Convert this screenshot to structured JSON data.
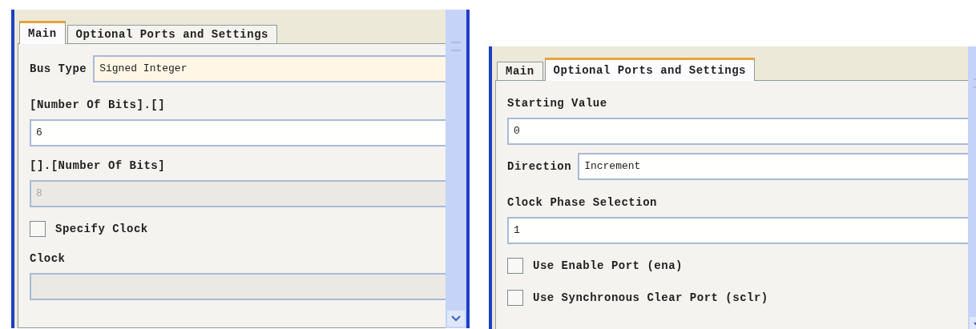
{
  "panels": [
    {
      "tabs": [
        {
          "label": "Main",
          "selected": true
        },
        {
          "label": "Optional Ports and Settings",
          "selected": false
        }
      ],
      "rows": [
        {
          "kind": "inline_field",
          "label": "Bus Type",
          "value": "Signed Integer",
          "focused": true
        },
        {
          "kind": "label",
          "label": "[Number Of Bits].[]"
        },
        {
          "kind": "field",
          "value": "6",
          "disabled": false
        },
        {
          "kind": "label",
          "label": "[].[Number Of Bits]"
        },
        {
          "kind": "field",
          "value": "8",
          "disabled": true
        },
        {
          "kind": "checkbox",
          "label": "Specify Clock",
          "checked": false
        },
        {
          "kind": "label",
          "label": "Clock"
        },
        {
          "kind": "field",
          "disabled": true
        }
      ]
    },
    {
      "tabs": [
        {
          "label": "Main",
          "selected": false
        },
        {
          "label": "Optional Ports and Settings",
          "selected": true
        }
      ],
      "rows": [
        {
          "kind": "label",
          "label": "Starting Value"
        },
        {
          "kind": "field",
          "value": "0",
          "disabled": false
        },
        {
          "kind": "inline_field",
          "label": "Direction",
          "value": "Increment",
          "focused": false
        },
        {
          "kind": "label",
          "label": "Clock Phase Selection"
        },
        {
          "kind": "field",
          "value": "1",
          "disabled": false
        },
        {
          "kind": "checkbox",
          "label": "Use Enable Port (ena)",
          "checked": false
        },
        {
          "kind": "checkbox",
          "label": "Use Synchronous Clear Port (sclr)",
          "checked": false
        }
      ]
    }
  ]
}
